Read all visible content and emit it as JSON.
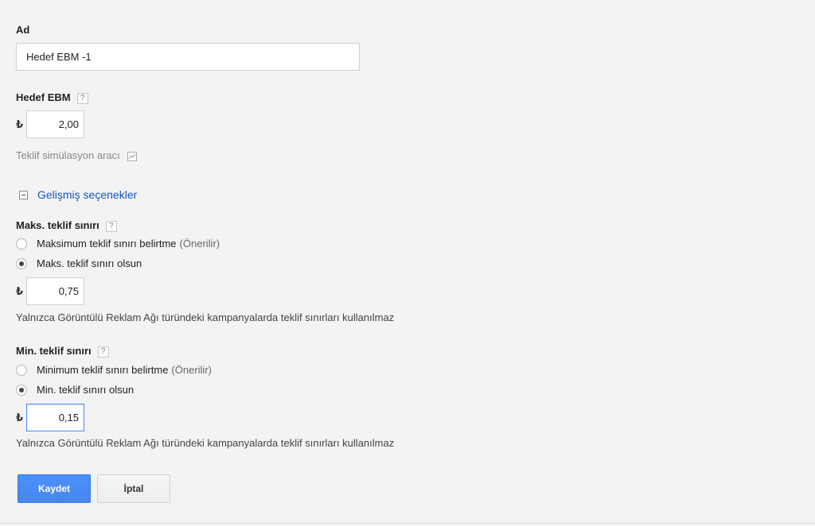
{
  "name_field": {
    "label": "Ad",
    "value": "Hedef EBM -1"
  },
  "target_cpa": {
    "label": "Hedef EBM",
    "currency": "₺",
    "value": "2,00",
    "help": "?"
  },
  "simulator": {
    "label": "Teklif simülasyon aracı",
    "icon": "chart-icon"
  },
  "advanced": {
    "label": "Gelişmiş seçenekler",
    "icon": "collapse-minus-icon"
  },
  "max_bid": {
    "label": "Maks. teklif sınırı",
    "help": "?",
    "option_none": "Maksimum teklif sınırı belirtme",
    "option_none_hint": "(Önerilir)",
    "option_set": "Maks. teklif sınırı olsun",
    "selected": "set",
    "currency": "₺",
    "value": "0,75",
    "note": "Yalnızca Görüntülü Reklam Ağı türündeki kampanyalarda teklif sınırları kullanılmaz"
  },
  "min_bid": {
    "label": "Min. teklif sınırı",
    "help": "?",
    "option_none": "Minimum teklif sınırı belirtme",
    "option_none_hint": "(Önerilir)",
    "option_set": "Min. teklif sınırı olsun",
    "selected": "set",
    "currency": "₺",
    "value": "0,15",
    "note": "Yalnızca Görüntülü Reklam Ağı türündeki kampanyalarda teklif sınırları kullanılmaz"
  },
  "buttons": {
    "save": "Kaydet",
    "cancel": "İptal"
  },
  "colors": {
    "primary": "#4d90fe",
    "link": "#1155cc",
    "background": "#f3f3f3"
  }
}
